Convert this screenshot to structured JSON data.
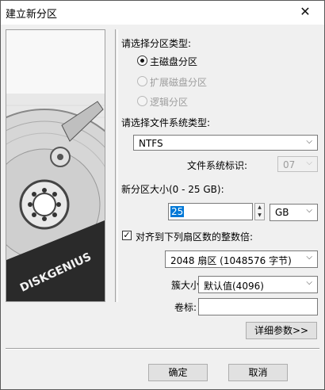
{
  "window": {
    "title": "建立新分区",
    "close_glyph": "✕"
  },
  "image": {
    "brand": "DISKGENIUS"
  },
  "partition_type": {
    "label": "请选择分区类型:",
    "options": [
      {
        "label": "主磁盘分区",
        "selected": true,
        "enabled": true
      },
      {
        "label": "扩展磁盘分区",
        "selected": false,
        "enabled": false
      },
      {
        "label": "逻辑分区",
        "selected": false,
        "enabled": false
      }
    ]
  },
  "filesystem": {
    "label": "请选择文件系统类型:",
    "value": "NTFS",
    "id_label": "文件系统标识:",
    "id_value": "07"
  },
  "size": {
    "label": "新分区大小(0 - 25 GB):",
    "value": "25",
    "unit": "GB"
  },
  "align": {
    "label": "对齐到下列扇区数的整数倍:",
    "checked": true,
    "check_glyph": "✓",
    "value": "2048 扇区 (1048576 字节)"
  },
  "cluster": {
    "label": "簇大小:",
    "value": "默认值(4096)"
  },
  "volume": {
    "label": "卷标:",
    "value": ""
  },
  "buttons": {
    "details": "详细参数>>",
    "ok": "确定",
    "cancel": "取消"
  },
  "icons": {
    "dropdown": "chevron-down-icon",
    "spin_up": "▲",
    "spin_down": "▼"
  }
}
